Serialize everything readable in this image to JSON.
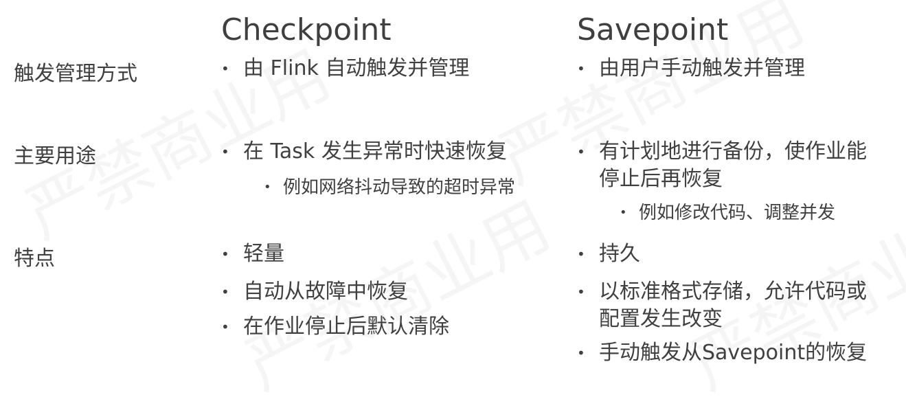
{
  "watermark": "严禁商业用",
  "columns": {
    "checkpoint": "Checkpoint",
    "savepoint": "Savepoint"
  },
  "rows": {
    "trigger": {
      "label": "触发管理方式",
      "checkpoint": "由 Flink 自动触发并管理",
      "savepoint": "由用户手动触发并管理"
    },
    "purpose": {
      "label": "主要用途",
      "checkpoint": "在 Task 发生异常时快速恢复",
      "checkpoint_sub": "例如网络抖动导致的超时异常",
      "savepoint": "有计划地进行备份，使作业能停止后再恢复",
      "savepoint_sub": "例如修改代码、调整并发"
    },
    "features": {
      "label": "特点",
      "checkpoint": [
        "轻量",
        "自动从故障中恢复",
        "在作业停止后默认清除"
      ],
      "savepoint": [
        "持久",
        "以标准格式存储，允许代码或配置发生改变",
        "手动触发从Savepoint的恢复"
      ]
    }
  },
  "bullet": "•"
}
